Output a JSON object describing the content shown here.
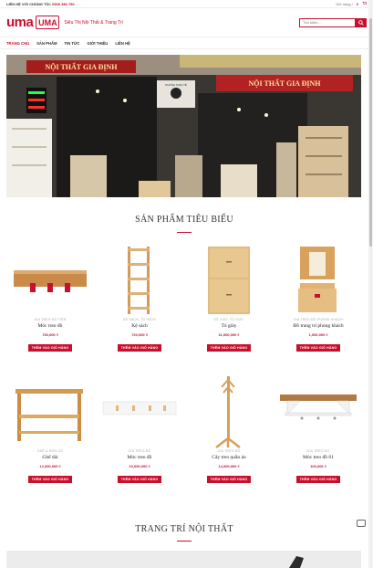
{
  "topbar": {
    "hotline_label": "LIÊN HỆ VỚI CHÚNG TÔI: ",
    "hotline_number": "0909 380 750",
    "cart_label": "Giỏ hàng /",
    "cart_count": "0"
  },
  "header": {
    "logo_text": "uma",
    "logo_mark": "UMA",
    "tagline": "Siêu Thị Nội Thất & Trang Trí",
    "search_placeholder": "Tìm kiếm..."
  },
  "nav": {
    "items": [
      "TRANG CHỦ",
      "SẢN PHẨM",
      "TIN TỨC",
      "GIỚI THIỆU",
      "LIÊN HỆ"
    ]
  },
  "hero": {
    "sign_left": "NỘI THẤT GIA ĐỊNH",
    "sign_right": "NỘI THẤT GIA ĐỊNH",
    "sign_small": "PHÒNG KINH TẾ"
  },
  "featured": {
    "title": "SẢN PHẨM TIÊU BIỂU",
    "cart_button": "THÊM VÀO GIỎ HÀNG",
    "products": [
      {
        "category": "GIA TREO ĐỒ TIỆN",
        "name": "Móc treo đồ",
        "price": "730,000 ₫"
      },
      {
        "category": "KỆ SÁCH, TỦ SÁCH",
        "name": "Kệ sách",
        "price": "720,000 ₫"
      },
      {
        "category": "KỆ GIÀY, TỦ GIÀY",
        "name": "Tủ giày",
        "price": "11,000,000 ₫"
      },
      {
        "category": "GIA TREO ĐỒ PHÒNG KHÁCH",
        "name": "Đồ trang trí phòng khách",
        "price": "1,000,000 ₫"
      },
      {
        "category": "GHẾ & ĐÔN GỖ",
        "name": "Ghế dài",
        "price": "12,000,000 ₫"
      },
      {
        "category": "GIA TREO ĐỒ",
        "name": "Móc treo đồ",
        "price": "10,000,000 ₫"
      },
      {
        "category": "GIA TREO ĐỒ",
        "name": "Cây treo quần áo",
        "price": "14,000,000 ₫"
      },
      {
        "category": "GIA TREO ĐỒ",
        "name": "Móc treo đồ 01",
        "price": "100,000 ₫"
      }
    ]
  },
  "decor": {
    "title": "TRANG TRÍ NỘI THẤT"
  },
  "colors": {
    "brand": "#c8102e"
  }
}
